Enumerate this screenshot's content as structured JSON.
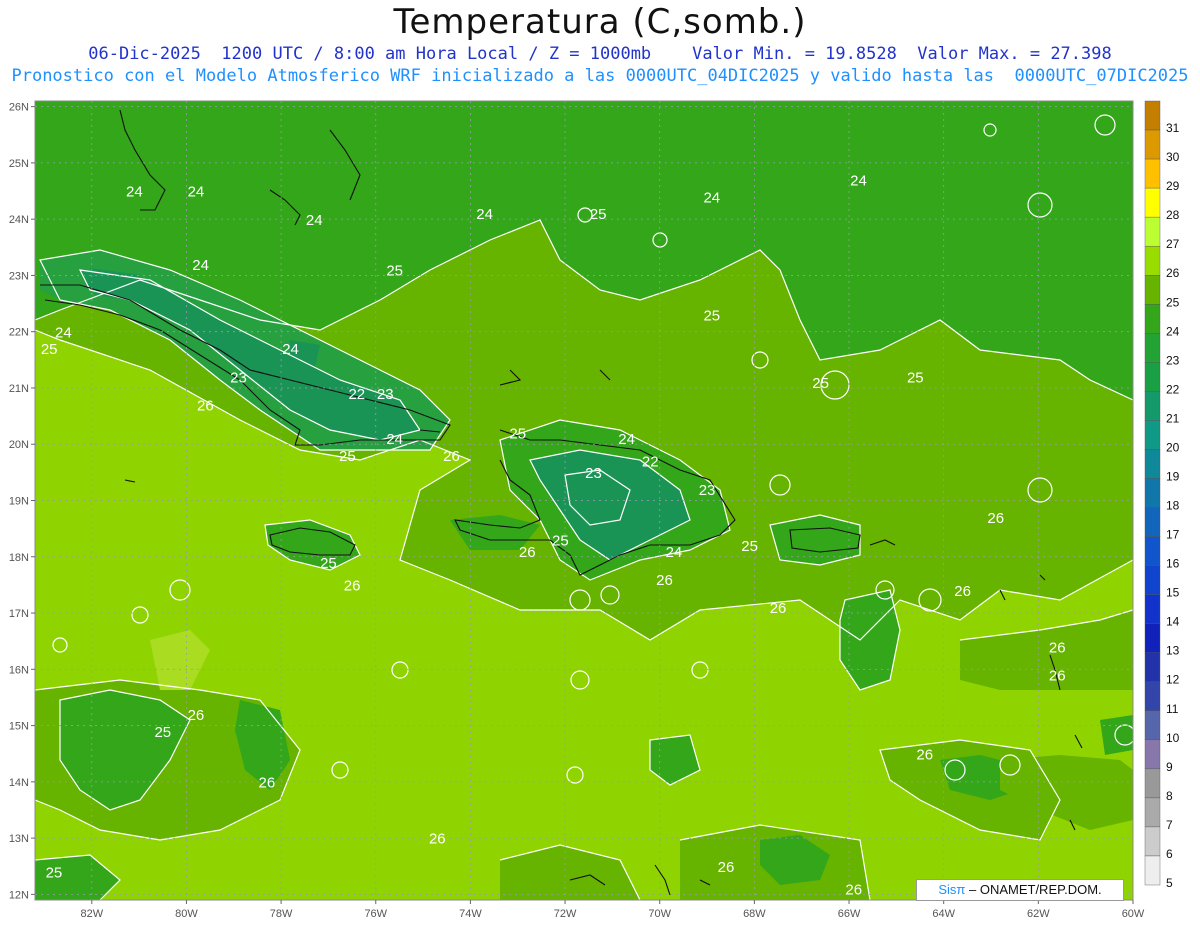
{
  "header": {
    "title": "Temperatura (C,somb.)",
    "subtitle_line1": "06-Dic-2025  1200 UTC / 8:00 am Hora Local / Z = 1000mb    Valor Min. = 19.8528  Valor Max. = 27.398",
    "subtitle_line2": "Pronostico con el Modelo Atmosferico WRF inicializado a las 0000UTC_04DIC2025 y valido hasta las  0000UTC_07DIC2025"
  },
  "map": {
    "lat_labels": [
      "26N",
      "25N",
      "24N",
      "23N",
      "22N",
      "21N",
      "20N",
      "19N",
      "18N",
      "17N",
      "16N",
      "15N",
      "14N",
      "13N",
      "12N"
    ],
    "lon_labels": [
      "82W",
      "80W",
      "78W",
      "76W",
      "74W",
      "72W",
      "70W",
      "68W",
      "66W",
      "64W",
      "62W",
      "60W"
    ],
    "contour_labels": [
      {
        "t": "24",
        "lon": -81.1,
        "lat": 24.4
      },
      {
        "t": "24",
        "lon": -79.8,
        "lat": 24.4
      },
      {
        "t": "24",
        "lon": -79.7,
        "lat": 23.1
      },
      {
        "t": "24",
        "lon": -82.6,
        "lat": 21.9
      },
      {
        "t": "25",
        "lon": -82.9,
        "lat": 21.6
      },
      {
        "t": "24",
        "lon": -77.8,
        "lat": 21.6
      },
      {
        "t": "23",
        "lon": -78.9,
        "lat": 21.1
      },
      {
        "t": "26",
        "lon": -79.6,
        "lat": 20.6
      },
      {
        "t": "22",
        "lon": -76.4,
        "lat": 20.8
      },
      {
        "t": "23",
        "lon": -75.8,
        "lat": 20.8
      },
      {
        "t": "24",
        "lon": -75.6,
        "lat": 20.0
      },
      {
        "t": "25",
        "lon": -76.6,
        "lat": 19.7
      },
      {
        "t": "26",
        "lon": -74.4,
        "lat": 19.7
      },
      {
        "t": "24",
        "lon": -77.3,
        "lat": 23.9
      },
      {
        "t": "24",
        "lon": -73.7,
        "lat": 24.0
      },
      {
        "t": "25",
        "lon": -75.6,
        "lat": 23.0
      },
      {
        "t": "25",
        "lon": -71.3,
        "lat": 24.0
      },
      {
        "t": "24",
        "lon": -68.9,
        "lat": 24.3
      },
      {
        "t": "24",
        "lon": -65.8,
        "lat": 24.6
      },
      {
        "t": "25",
        "lon": -68.9,
        "lat": 22.2
      },
      {
        "t": "25",
        "lon": -66.6,
        "lat": 21.0
      },
      {
        "t": "25",
        "lon": -64.6,
        "lat": 21.1
      },
      {
        "t": "25",
        "lon": -73.0,
        "lat": 20.1
      },
      {
        "t": "24",
        "lon": -70.7,
        "lat": 20.0
      },
      {
        "t": "22",
        "lon": -70.2,
        "lat": 19.6
      },
      {
        "t": "23",
        "lon": -71.4,
        "lat": 19.4
      },
      {
        "t": "23",
        "lon": -69.0,
        "lat": 19.1
      },
      {
        "t": "25",
        "lon": -68.1,
        "lat": 18.1
      },
      {
        "t": "24",
        "lon": -69.7,
        "lat": 18.0
      },
      {
        "t": "26",
        "lon": -69.9,
        "lat": 17.5
      },
      {
        "t": "25",
        "lon": -72.1,
        "lat": 18.2
      },
      {
        "t": "26",
        "lon": -72.8,
        "lat": 18.0
      },
      {
        "t": "25",
        "lon": -77.0,
        "lat": 17.8
      },
      {
        "t": "26",
        "lon": -76.5,
        "lat": 17.4
      },
      {
        "t": "26",
        "lon": -67.5,
        "lat": 17.0
      },
      {
        "t": "26",
        "lon": -62.9,
        "lat": 18.6
      },
      {
        "t": "26",
        "lon": -63.6,
        "lat": 17.3
      },
      {
        "t": "26",
        "lon": -61.6,
        "lat": 16.3
      },
      {
        "t": "26",
        "lon": -61.6,
        "lat": 15.8
      },
      {
        "t": "26",
        "lon": -79.8,
        "lat": 15.1
      },
      {
        "t": "25",
        "lon": -80.5,
        "lat": 14.8
      },
      {
        "t": "26",
        "lon": -78.3,
        "lat": 13.9
      },
      {
        "t": "26",
        "lon": -74.7,
        "lat": 12.9
      },
      {
        "t": "26",
        "lon": -68.6,
        "lat": 12.4
      },
      {
        "t": "26",
        "lon": -65.9,
        "lat": 12.0
      },
      {
        "t": "26",
        "lon": -64.4,
        "lat": 14.4
      },
      {
        "t": "25",
        "lon": -82.8,
        "lat": 12.3
      }
    ]
  },
  "colorbar": {
    "labels": [
      "31",
      "30",
      "29",
      "28",
      "27",
      "26",
      "25",
      "24",
      "23",
      "22",
      "21",
      "20",
      "19",
      "18",
      "17",
      "16",
      "15",
      "14",
      "13",
      "12",
      "11",
      "10",
      "9",
      "8",
      "7",
      "6",
      "5"
    ],
    "colors": [
      "#c47e00",
      "#dc9a00",
      "#ffc000",
      "#ffff00",
      "#bbff33",
      "#99dd00",
      "#66b300",
      "#33a61a",
      "#22a333",
      "#1aa044",
      "#14996b",
      "#119988",
      "#0f8899",
      "#1177aa",
      "#1166bb",
      "#1155cc",
      "#1144cc",
      "#1133cc",
      "#1122bb",
      "#2233aa",
      "#3344aa",
      "#5566aa",
      "#8877aa",
      "#999999",
      "#aaaaaa",
      "#cccccc",
      "#eeeeee"
    ]
  },
  "branding": {
    "prefix": "Sisπ",
    "suffix": "– ONAMET/REP.DOM."
  }
}
